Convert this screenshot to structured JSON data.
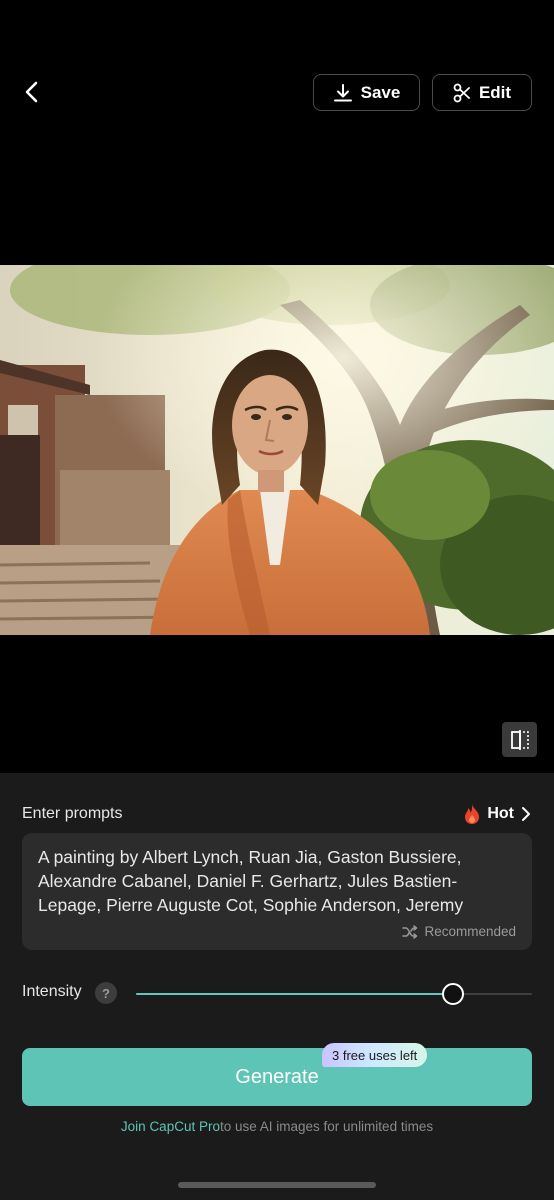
{
  "toolbar": {
    "save_label": "Save",
    "edit_label": "Edit"
  },
  "icons": {
    "back": "chevron-left-icon",
    "save": "download-icon",
    "edit": "scissors-icon",
    "compare": "compare-icon",
    "hot": "flame-icon",
    "hot_chevron": "chevron-right-icon",
    "recommended": "shuffle-icon"
  },
  "prompt": {
    "label": "Enter prompts",
    "hot_label": "Hot",
    "text": "A painting by Albert Lynch, Ruan Jia, Gaston Bussiere, Alexandre Cabanel, Daniel F. Gerhartz, Jules Bastien-Lepage, Pierre Auguste Cot, Sophie Anderson, Jeremy",
    "recommended_label": "Recommended"
  },
  "intensity": {
    "label": "Intensity",
    "help": "?",
    "value": 0.8
  },
  "generate": {
    "label": "Generate",
    "badge": "3 free uses left"
  },
  "footer": {
    "link": "Join CapCut Pro",
    "text": "to use AI images for unlimited times"
  },
  "colors": {
    "accent": "#5ec4b6",
    "background": "#000000",
    "panel": "#1b1b1b",
    "hot": "#e8442c"
  }
}
